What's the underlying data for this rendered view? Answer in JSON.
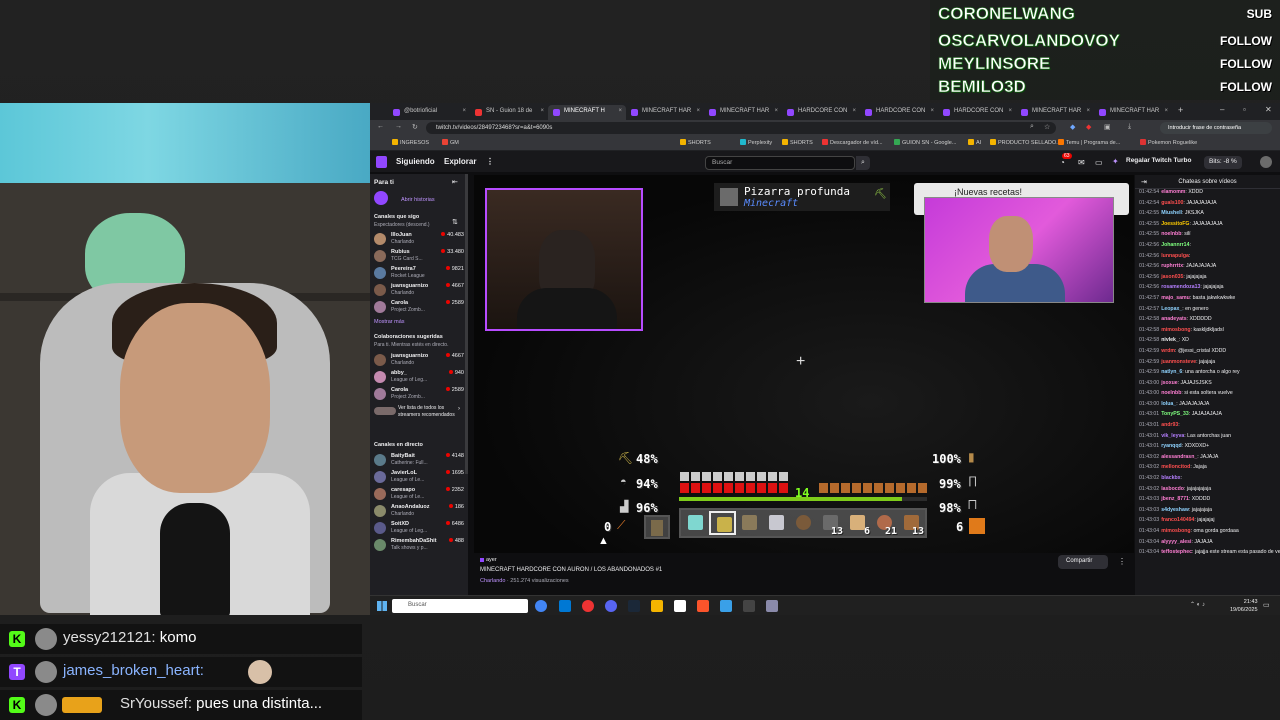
{
  "overlay_events": [
    {
      "name": "CORONELWANG",
      "type": "SUB"
    },
    {
      "name": "OSCARVOLANDOVOY",
      "type": "FOLLOW"
    },
    {
      "name": "MEYLINSORE",
      "type": "FOLLOW"
    },
    {
      "name": "BEMILO3D",
      "type": "FOLLOW"
    }
  ],
  "browser": {
    "tabs": [
      {
        "label": "@botrioficial"
      },
      {
        "label": "SN - Guion 18 de"
      },
      {
        "label": "MINECRAFT H"
      },
      {
        "label": "MINECRAFT HAR"
      },
      {
        "label": "MINECRAFT HAR"
      },
      {
        "label": "HARDCORE CON"
      },
      {
        "label": "HARDCORE CON"
      },
      {
        "label": "HARDCORE CON"
      },
      {
        "label": "MINECRAFT HAR"
      },
      {
        "label": "MINECRAFT HAR"
      }
    ],
    "new_tab": "+",
    "url": "twitch.tv/videos/2849723468?sr=a&t=6090s",
    "translate_label": "Introducir frase de contraseña",
    "bookmarks": [
      "INGRESOS",
      "GM",
      "SHORTS",
      "Perplexity",
      "SHORTS",
      "Descargador de víd...",
      "GUION SN - Google...",
      "AI",
      "PRODUCTO SELLADO...",
      "Temu | Programa de...",
      "Pokemon Roguelike"
    ]
  },
  "twitch": {
    "following": "Siguiendo",
    "explore": "Explorar",
    "more": "⋮",
    "search_placeholder": "Buscar",
    "notif_count": "63",
    "turbo": "Regalar Twitch Turbo",
    "bits": "Bits: -8 %"
  },
  "sidebar": {
    "title": "Para ti",
    "history_link": "Abrir historias",
    "live_header": "Canales que sigo",
    "live_sub": "Espectadores (descend.)",
    "live": [
      {
        "name": "IlloJuan",
        "game": "Charlando",
        "viewers": "40.483"
      },
      {
        "name": "Rubius",
        "game": "TCG Card S...",
        "viewers": "33.480"
      },
      {
        "name": "Peereira7",
        "game": "Rocket League",
        "viewers": "9821"
      },
      {
        "name": "juansguarnizo",
        "game": "Charlando",
        "viewers": "4667"
      },
      {
        "name": "Carola",
        "game": "Project Zomb...",
        "viewers": "2589"
      }
    ],
    "show_more": "Mostrar más",
    "collab_header": "Colaboraciones sugeridas",
    "collab_sub": "Para ti. Mientras estés en directo.",
    "collabs": [
      {
        "name": "juansguarnizo",
        "game": "Charlando",
        "viewers": "4667"
      },
      {
        "name": "abby_",
        "game": "League of Leg...",
        "viewers": "940"
      },
      {
        "name": "Carola",
        "game": "Project Zomb...",
        "viewers": "2589"
      }
    ],
    "see_all": "Ver lista de todos los streamers recomendados",
    "direct_header": "Canales en directo",
    "direct": [
      {
        "name": "BaityBait",
        "game": "Catherine: Full...",
        "viewers": "4148"
      },
      {
        "name": "JavierLoL",
        "game": "League of Le...",
        "viewers": "1695"
      },
      {
        "name": "caresapo",
        "game": "League of Le...",
        "viewers": "2352"
      },
      {
        "name": "AnaoAndaluoz",
        "game": "Charlando",
        "viewers": "186"
      },
      {
        "name": "SoitXD",
        "game": "League of Leg...",
        "viewers": "6486"
      },
      {
        "name": "RimembahDaShit",
        "game": "Talk shows y p...",
        "viewers": "488"
      }
    ]
  },
  "game": {
    "advancement_title": "Pizarra profunda",
    "advancement_sub": "Minecraft",
    "toast": "¡Nuevas recetas!",
    "stats_left": [
      "48%",
      "94%",
      "96%"
    ],
    "stats_right": [
      "100%",
      "99%",
      "98%"
    ],
    "xp_level": "14",
    "xp_progress": 0.9,
    "health_hearts": 10,
    "food_shanks": 10,
    "offhand_count": "0",
    "right_count": "6",
    "hotbar_counts": [
      "",
      "",
      "",
      "",
      "",
      "13",
      "6",
      "21",
      "13"
    ],
    "hotbar_selected": 1
  },
  "video": {
    "ago": "ayer",
    "title": "MINECRAFT HARDCORE CON AURON / LOS ABANDONADOS #1",
    "category": "Charlando",
    "views": "251.274 visualizaciones",
    "share": "Compartir"
  },
  "chat": {
    "header": "Chateas sobre vídeos",
    "messages": [
      {
        "ts": "01:42:54",
        "user": "elamomm",
        "color": "#ff7fd4",
        "text": "XDDD"
      },
      {
        "ts": "01:42:54",
        "user": "guals100",
        "color": "#ff4f4f",
        "text": "JAJAJAJAJA"
      },
      {
        "ts": "01:42:55",
        "user": "Miushell",
        "color": "#8fd3ff",
        "text": "JKSJKA"
      },
      {
        "ts": "01:42:55",
        "user": "JoessitoFG",
        "color": "#ffcc00",
        "text": "JAJAJAJAJA"
      },
      {
        "ts": "01:42:55",
        "user": "noelnbb",
        "color": "#ff7fd4",
        "text": "silí"
      },
      {
        "ts": "01:42:56",
        "user": "Johannrr14",
        "color": "#7fff7f",
        "text": ""
      },
      {
        "ts": "01:42:56",
        "user": "lunnapulga",
        "color": "#ff4f4f",
        "text": ""
      },
      {
        "ts": "01:42:56",
        "user": "ruphrrttx",
        "color": "#ff7fd4",
        "text": "JAJAJAJAJA"
      },
      {
        "ts": "01:42:56",
        "user": "jason035",
        "color": "#ff4f4f",
        "text": "jajajajaja"
      },
      {
        "ts": "01:42:56",
        "user": "rosamendoza13",
        "color": "#b57fff",
        "text": "jajajajaja"
      },
      {
        "ts": "01:42:57",
        "user": "majo_samu",
        "color": "#ff7fd4",
        "text": "basta jakwkwkwke"
      },
      {
        "ts": "01:42:57",
        "user": "Leopax_",
        "color": "#8fd3ff",
        "text": "en genero"
      },
      {
        "ts": "01:42:58",
        "user": "anadeyats",
        "color": "#ff7fd4",
        "text": "XDDDDD"
      },
      {
        "ts": "01:42:58",
        "user": "mimosbong",
        "color": "#ff4f4f",
        "text": "kaskljdkljadsl"
      },
      {
        "ts": "01:42:58",
        "user": "nivlek_",
        "color": "#efeff1",
        "text": "XD"
      },
      {
        "ts": "01:42:59",
        "user": "wrdm",
        "color": "#ff4f4f",
        "text": "@jessi_cristal XDDD"
      },
      {
        "ts": "01:42:59",
        "user": "juanmonsteve",
        "color": "#ff4f4f",
        "text": "jajajaja"
      },
      {
        "ts": "01:42:59",
        "user": "natlyn_6",
        "color": "#8fd3ff",
        "text": "una antorcha o algo rey"
      },
      {
        "ts": "01:43:00",
        "user": "jsoxue",
        "color": "#ff7fd4",
        "text": "JAJAJSJSKS"
      },
      {
        "ts": "01:43:00",
        "user": "noelnbb",
        "color": "#ff7fd4",
        "text": "si esta soltera vuelve"
      },
      {
        "ts": "01:43:00",
        "user": "lolua_",
        "color": "#8fd3ff",
        "text": "JAJAJAJAJA"
      },
      {
        "ts": "01:43:01",
        "user": "TonyPS_33",
        "color": "#7fff7f",
        "text": "JAJAJAJAJA"
      },
      {
        "ts": "01:43:01",
        "user": "andr93",
        "color": "#ff4f4f",
        "text": ""
      },
      {
        "ts": "01:43:01",
        "user": "vik_leyva",
        "color": "#b57fff",
        "text": "Las antorchas juan"
      },
      {
        "ts": "01:43:01",
        "user": "ryanqqd",
        "color": "#8fd3ff",
        "text": "XDXDXD+"
      },
      {
        "ts": "01:43:02",
        "user": "alessandrasn_",
        "color": "#ff7fd4",
        "text": "JAJAJA"
      },
      {
        "ts": "01:43:02",
        "user": "melloncitod",
        "color": "#ff4f4f",
        "text": "Jajaja"
      },
      {
        "ts": "01:43:02",
        "user": "blackbx",
        "color": "#b57fff",
        "text": ""
      },
      {
        "ts": "01:43:02",
        "user": "lasbocdo",
        "color": "#ff7fd4",
        "text": "jajajajajaja"
      },
      {
        "ts": "01:43:03",
        "user": "jbenz_8771",
        "color": "#ff7fd4",
        "text": "XDDDD"
      },
      {
        "ts": "01:43:03",
        "user": "s4dyeshaw",
        "color": "#8fd3ff",
        "text": "jajajajaja"
      },
      {
        "ts": "01:43:03",
        "user": "franco140494",
        "color": "#ff4f4f",
        "text": "jajajajaj"
      },
      {
        "ts": "01:43:04",
        "user": "mimosbong",
        "color": "#ff4f4f",
        "text": "oma gorda gordaaa"
      },
      {
        "ts": "01:43:04",
        "user": "alyyyy_alesi",
        "color": "#ff7fd4",
        "text": "JAJAJA"
      },
      {
        "ts": "01:43:04",
        "user": "teffostephec",
        "color": "#ff7fd4",
        "text": "jajajja este stream esta pasado de verga"
      }
    ]
  },
  "taskbar": {
    "search": "Buscar",
    "time": "21:43",
    "date": "19/06/2025"
  },
  "overlay_chat": [
    {
      "platform": "K",
      "platform_color": "#53fc18",
      "user": "yessy212121:",
      "text": " komo",
      "user_color": "normal"
    },
    {
      "platform": "T",
      "platform_color": "#9147ff",
      "user": "james_broken_heart:",
      "text": "",
      "user_color": "blue"
    },
    {
      "platform": "K",
      "platform_color": "#53fc18",
      "user": "SrYoussef:",
      "text": " pues una distinta...",
      "user_color": "normal"
    }
  ],
  "colors": {
    "twitch_purple": "#9147ff",
    "kick_green": "#53fc18",
    "xp_green": "#7fcc1a"
  }
}
